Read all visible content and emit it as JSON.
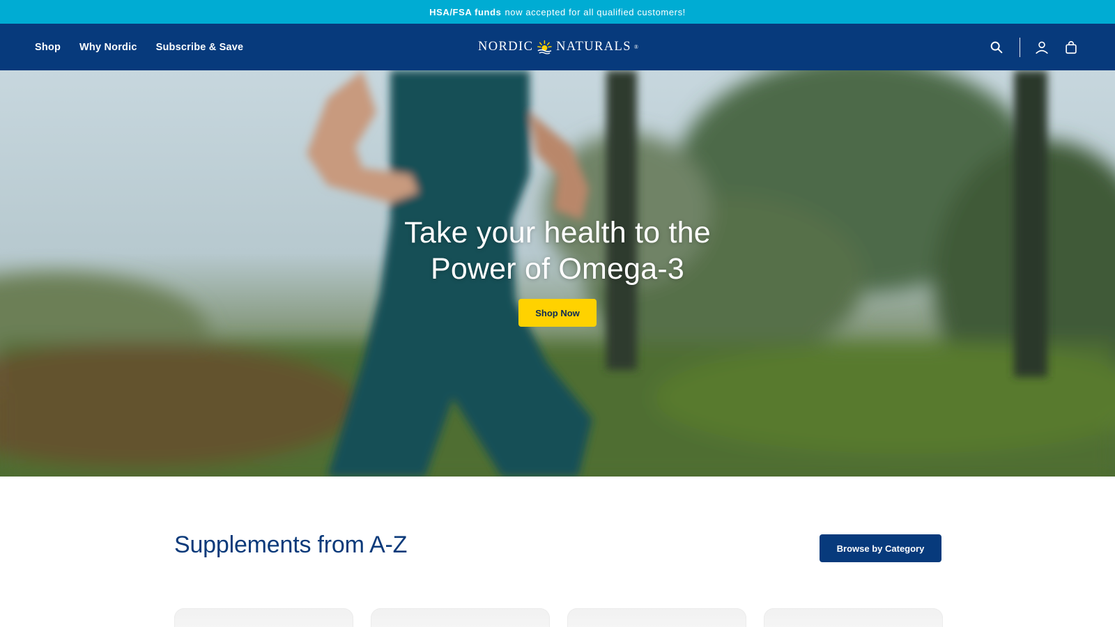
{
  "announcement": {
    "bold": "HSA/FSA funds",
    "rest": "now accepted for all qualified customers!"
  },
  "header": {
    "nav": [
      "Shop",
      "Why Nordic",
      "Subscribe & Save"
    ],
    "logo": {
      "left": "NORDIC",
      "right": "NATURALS",
      "mark": "®"
    },
    "icons": [
      "search-icon",
      "account-icon",
      "cart-icon"
    ]
  },
  "hero": {
    "title_line1": "Take your health to the",
    "title_line2": "Power of Omega-3",
    "cta": "Shop Now"
  },
  "supplements": {
    "title": "Supplements from A-Z",
    "browse": "Browse by Category",
    "cards": 4
  },
  "colors": {
    "announce_bg": "#00acd3",
    "header_bg": "#073a7c",
    "cta_yellow": "#ffd200",
    "brand_blue": "#0b3a7a"
  }
}
